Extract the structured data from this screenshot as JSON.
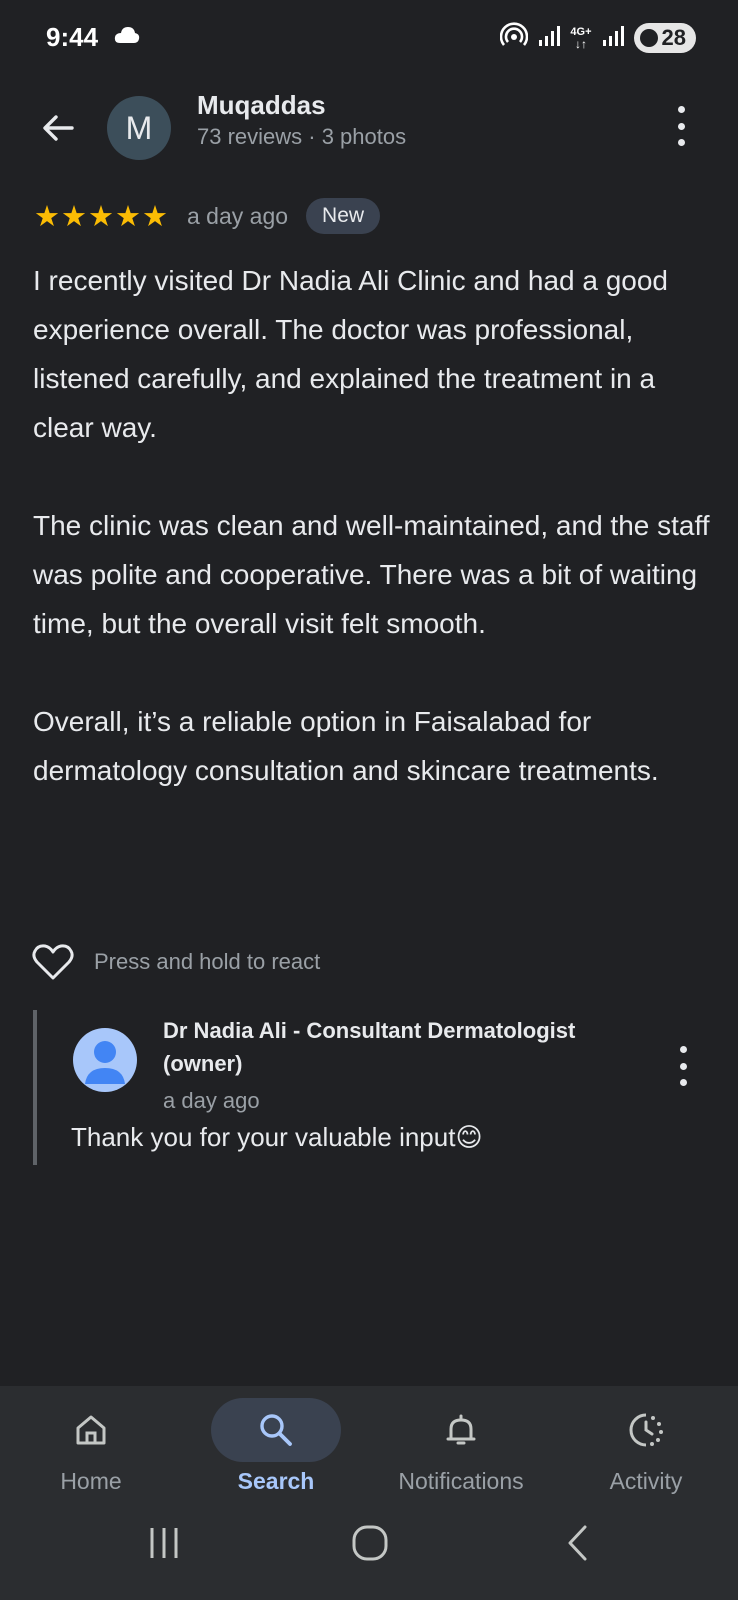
{
  "status_bar": {
    "time": "9:44",
    "left_icons": [
      "cloud-icon"
    ],
    "right_icons": [
      "hotspot-icon",
      "signal-icon",
      "4g-plus-icon",
      "signal-icon"
    ],
    "network_label": "4G+",
    "battery": "28"
  },
  "header": {
    "avatar_letter": "M",
    "name": "Muqaddas",
    "meta": "73 reviews · 3 photos"
  },
  "review": {
    "stars": "★★★★★",
    "rating": 5,
    "time_ago": "a day ago",
    "badge": "New",
    "paragraphs": [
      "I recently visited Dr Nadia Ali Clinic and had a good experience overall. The doctor was professional, listened carefully, and explained the treatment in a clear way.",
      "The clinic was clean and well-maintained, and the staff was polite and cooperative. There was a bit of waiting time, but the overall visit felt smooth.",
      "Overall, it’s a reliable option in Faisalabad for dermatology consultation and skincare treatments."
    ],
    "react_hint": "Press and hold to react"
  },
  "owner_reply": {
    "name": "Dr Nadia Ali - Consultant Dermatologist (owner)",
    "time_ago": "a day ago",
    "text": "Thank you for your valuable input😊"
  },
  "bottom_nav": {
    "items": [
      {
        "label": "Home",
        "icon": "home-icon",
        "active": false
      },
      {
        "label": "Search",
        "icon": "search-icon",
        "active": true
      },
      {
        "label": "Notifications",
        "icon": "bell-icon",
        "active": false
      },
      {
        "label": "Activity",
        "icon": "activity-icon",
        "active": false
      }
    ]
  },
  "colors": {
    "background": "#202124",
    "star": "#fbbc04",
    "accent": "#a8c7fa",
    "nav_background": "#2b2d30"
  }
}
